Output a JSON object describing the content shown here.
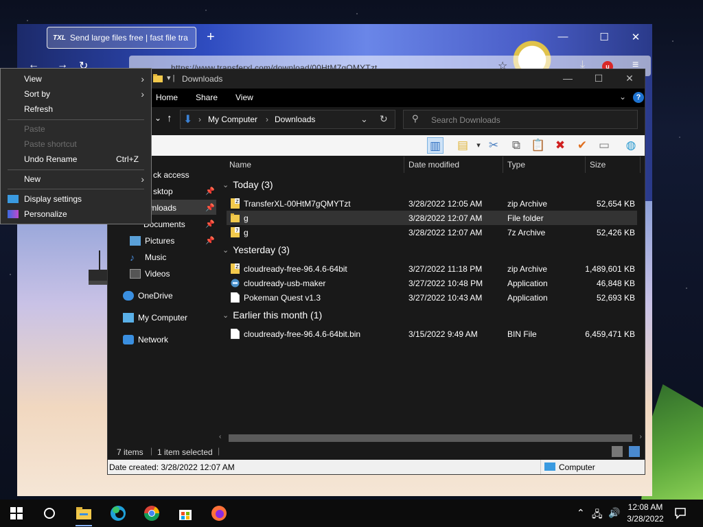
{
  "browser": {
    "tab_title": "Send large files free | fast file tra",
    "tab_favicon": "TXL",
    "url": "https://www.transferxl.com/download/00HtM7gQMYTzt",
    "new_tab": "+"
  },
  "context_menu": {
    "view": "View",
    "sort_by": "Sort by",
    "refresh": "Refresh",
    "paste": "Paste",
    "paste_shortcut": "Paste shortcut",
    "undo_rename": "Undo Rename",
    "undo_rename_shortcut": "Ctrl+Z",
    "new": "New",
    "display_settings": "Display settings",
    "personalize": "Personalize"
  },
  "explorer": {
    "title": "Downloads",
    "ribbon_tabs": [
      "Home",
      "Share",
      "View"
    ],
    "breadcrumb": [
      "My Computer",
      "Downloads"
    ],
    "search_placeholder": "Search Downloads",
    "nav_items": {
      "quick_access": "ck access",
      "desktop": "sktop",
      "downloads": "wnloads",
      "documents": "Documents",
      "pictures": "Pictures",
      "music": "Music",
      "videos": "Videos",
      "onedrive": "OneDrive",
      "my_computer": "My Computer",
      "network": "Network"
    },
    "columns": {
      "name": "Name",
      "date": "Date modified",
      "type": "Type",
      "size": "Size"
    },
    "groups": {
      "today": "Today (3)",
      "yesterday": "Yesterday (3)",
      "earlier": "Earlier this month (1)"
    },
    "files_today": [
      {
        "name": "TransferXL-00HtM7gQMYTzt",
        "date": "3/28/2022 12:05 AM",
        "type": "zip Archive",
        "size": "52,654 KB"
      },
      {
        "name": "g",
        "date": "3/28/2022 12:07 AM",
        "type": "File folder",
        "size": ""
      },
      {
        "name": "g",
        "date": "3/28/2022 12:07 AM",
        "type": "7z Archive",
        "size": "52,426 KB"
      }
    ],
    "files_yesterday": [
      {
        "name": "cloudready-free-96.4.6-64bit",
        "date": "3/27/2022 11:18 PM",
        "type": "zip Archive",
        "size": "1,489,601 KB"
      },
      {
        "name": "cloudready-usb-maker",
        "date": "3/27/2022 10:48 PM",
        "type": "Application",
        "size": "46,848 KB"
      },
      {
        "name": "Pokeman Quest v1.3",
        "date": "3/27/2022 10:43 AM",
        "type": "Application",
        "size": "52,693 KB"
      }
    ],
    "files_earlier": [
      {
        "name": "cloudready-free-96.4.6-64bit.bin",
        "date": "3/15/2022 9:49 AM",
        "type": "BIN File",
        "size": "6,459,471 KB"
      }
    ],
    "status_items": "7 items",
    "status_selected": "1 item selected",
    "detail_left": "Date created: 3/28/2022 12:07 AM",
    "detail_right": "Computer"
  },
  "taskbar": {
    "time": "12:08 AM",
    "date": "3/28/2022"
  }
}
